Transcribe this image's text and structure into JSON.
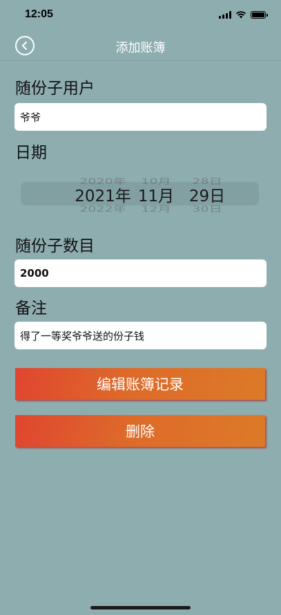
{
  "status_bar": {
    "time": "12:05"
  },
  "nav": {
    "title": "添加账簿",
    "back_icon": "chevron-left-icon"
  },
  "form": {
    "user_label": "随份子用户",
    "user_value": "爷爷",
    "date_label": "日期",
    "date_picker": {
      "prev": {
        "year": "2020年",
        "month": "10月",
        "day": "28日"
      },
      "current": {
        "year": "2021年",
        "month": "11月",
        "day": "29日"
      },
      "next": {
        "year": "2022年",
        "month": "12月",
        "day": "30日"
      }
    },
    "amount_label": "随份子数目",
    "amount_value": "2000",
    "note_label": "备注",
    "note_value": "得了一等奖爷爷送的份子钱"
  },
  "actions": {
    "edit_label": "编辑账簿记录",
    "delete_label": "删除"
  },
  "colors": {
    "background": "#8eadaf",
    "button_gradient_start": "#e04530",
    "button_gradient_end": "#dc7a28",
    "field_background": "#ffffff"
  }
}
